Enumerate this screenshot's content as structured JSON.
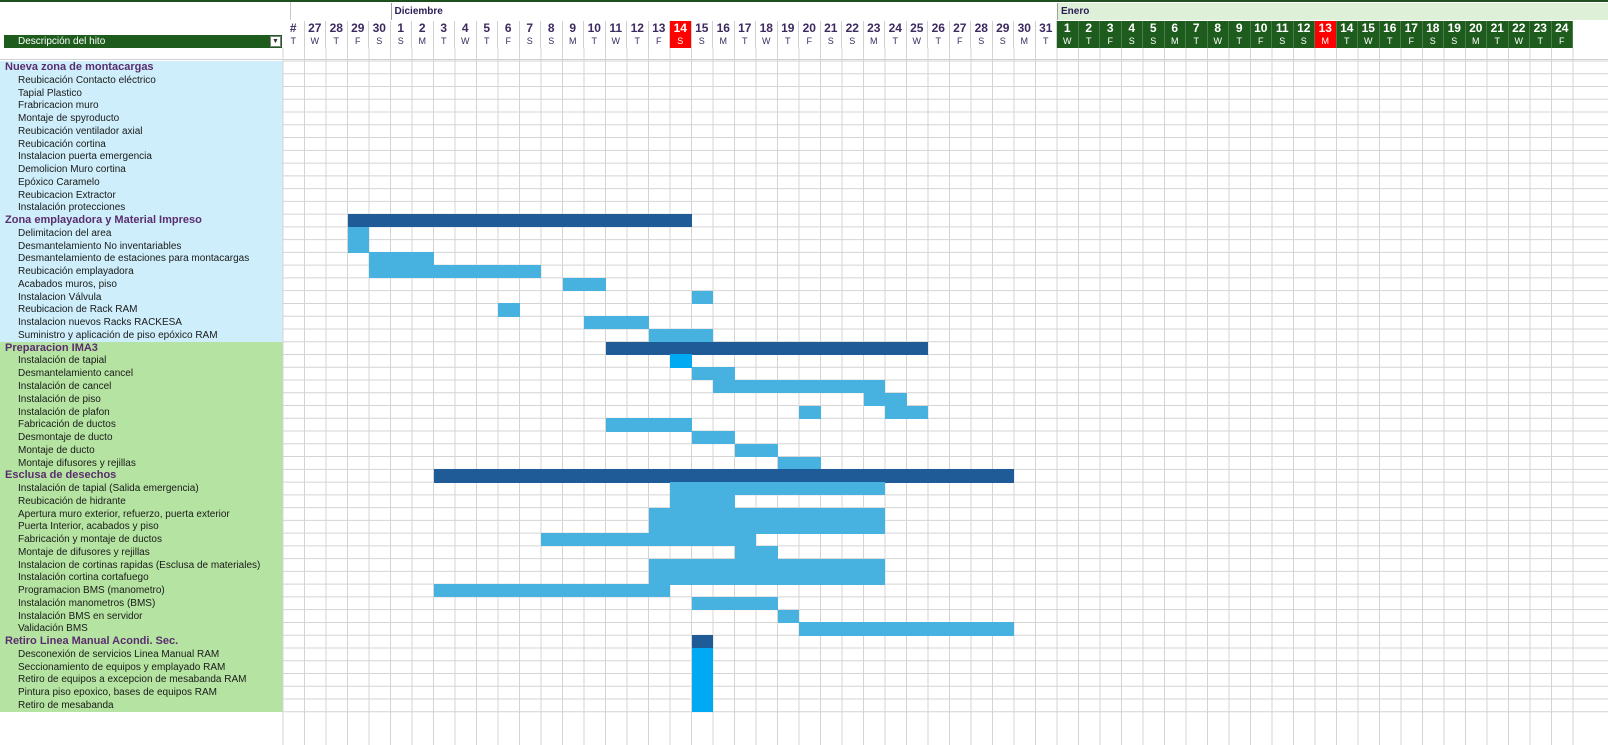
{
  "timeline": {
    "months": [
      {
        "label": "Diciembre",
        "startDay": 5
      },
      {
        "label": "Enero",
        "startDay": 36
      }
    ],
    "days": [
      {
        "num": "#",
        "dow": "T"
      },
      {
        "num": "27",
        "dow": "W"
      },
      {
        "num": "28",
        "dow": "T"
      },
      {
        "num": "29",
        "dow": "F"
      },
      {
        "num": "30",
        "dow": "S"
      },
      {
        "num": "1",
        "dow": "S"
      },
      {
        "num": "2",
        "dow": "M"
      },
      {
        "num": "3",
        "dow": "T"
      },
      {
        "num": "4",
        "dow": "W"
      },
      {
        "num": "5",
        "dow": "T"
      },
      {
        "num": "6",
        "dow": "F"
      },
      {
        "num": "7",
        "dow": "S"
      },
      {
        "num": "8",
        "dow": "S"
      },
      {
        "num": "9",
        "dow": "M"
      },
      {
        "num": "10",
        "dow": "T"
      },
      {
        "num": "11",
        "dow": "W"
      },
      {
        "num": "12",
        "dow": "T"
      },
      {
        "num": "13",
        "dow": "F"
      },
      {
        "num": "14",
        "dow": "S",
        "highlight": true
      },
      {
        "num": "15",
        "dow": "S"
      },
      {
        "num": "16",
        "dow": "M"
      },
      {
        "num": "17",
        "dow": "T"
      },
      {
        "num": "18",
        "dow": "W"
      },
      {
        "num": "19",
        "dow": "T"
      },
      {
        "num": "20",
        "dow": "F"
      },
      {
        "num": "21",
        "dow": "S"
      },
      {
        "num": "22",
        "dow": "S"
      },
      {
        "num": "23",
        "dow": "M"
      },
      {
        "num": "24",
        "dow": "T"
      },
      {
        "num": "25",
        "dow": "W"
      },
      {
        "num": "26",
        "dow": "T"
      },
      {
        "num": "27",
        "dow": "F"
      },
      {
        "num": "28",
        "dow": "S"
      },
      {
        "num": "29",
        "dow": "S"
      },
      {
        "num": "30",
        "dow": "M"
      },
      {
        "num": "31",
        "dow": "T"
      },
      {
        "num": "1",
        "dow": "W",
        "jan": true
      },
      {
        "num": "2",
        "dow": "T",
        "jan": true
      },
      {
        "num": "3",
        "dow": "F",
        "jan": true
      },
      {
        "num": "4",
        "dow": "S",
        "jan": true
      },
      {
        "num": "5",
        "dow": "S",
        "jan": true
      },
      {
        "num": "6",
        "dow": "M",
        "jan": true
      },
      {
        "num": "7",
        "dow": "T",
        "jan": true
      },
      {
        "num": "8",
        "dow": "W",
        "jan": true
      },
      {
        "num": "9",
        "dow": "T",
        "jan": true
      },
      {
        "num": "10",
        "dow": "F",
        "jan": true
      },
      {
        "num": "11",
        "dow": "S",
        "jan": true
      },
      {
        "num": "12",
        "dow": "S",
        "jan": true
      },
      {
        "num": "13",
        "dow": "M",
        "jan": true,
        "highlight": true
      },
      {
        "num": "14",
        "dow": "T",
        "jan": true
      },
      {
        "num": "15",
        "dow": "W",
        "jan": true
      },
      {
        "num": "16",
        "dow": "T",
        "jan": true
      },
      {
        "num": "17",
        "dow": "F",
        "jan": true
      },
      {
        "num": "18",
        "dow": "S",
        "jan": true
      },
      {
        "num": "19",
        "dow": "S",
        "jan": true
      },
      {
        "num": "20",
        "dow": "M",
        "jan": true
      },
      {
        "num": "21",
        "dow": "T",
        "jan": true
      },
      {
        "num": "22",
        "dow": "W",
        "jan": true
      },
      {
        "num": "23",
        "dow": "T",
        "jan": true
      },
      {
        "num": "24",
        "dow": "F",
        "jan": true
      }
    ]
  },
  "header": {
    "description_label": "Descripción del hito",
    "filter_glyph": "▼"
  },
  "colors": {
    "summary_bar": "#1f5b96",
    "task_bar": "#47b1e0",
    "accent_bar": "#00aaf2",
    "blue_band": "#cdeefa",
    "green_band": "#b5e4a2",
    "highlight": "#ff0000",
    "header_green": "#1e5c1e"
  },
  "rows": [
    {
      "type": "category",
      "band": "blue",
      "label": "Nueva zona de montacargas",
      "bars": []
    },
    {
      "type": "task",
      "band": "blue",
      "label": "Reubicación Contacto eléctrico",
      "bars": []
    },
    {
      "type": "task",
      "band": "blue",
      "label": "Tapial Plastico",
      "bars": []
    },
    {
      "type": "task",
      "band": "blue",
      "label": "Frabricacion muro",
      "bars": []
    },
    {
      "type": "task",
      "band": "blue",
      "label": "Montaje de spyroducto",
      "bars": []
    },
    {
      "type": "task",
      "band": "blue",
      "label": "Reubicación ventilador axial",
      "bars": []
    },
    {
      "type": "task",
      "band": "blue",
      "label": "Reubicación cortina",
      "bars": []
    },
    {
      "type": "task",
      "band": "blue",
      "label": "Instalacion puerta emergencia",
      "bars": []
    },
    {
      "type": "task",
      "band": "blue",
      "label": "Demolicion Muro cortina",
      "bars": []
    },
    {
      "type": "task",
      "band": "blue",
      "label": "Epóxico Caramelo",
      "bars": []
    },
    {
      "type": "task",
      "band": "blue",
      "label": "Reubicacion Extractor",
      "bars": []
    },
    {
      "type": "task",
      "band": "blue",
      "label": "Instalación protecciones",
      "bars": []
    },
    {
      "type": "category",
      "band": "blue",
      "label": "Zona emplayadora y Material Impreso",
      "bars": [
        {
          "start": 3,
          "end": 19,
          "kind": "summary"
        }
      ]
    },
    {
      "type": "task",
      "band": "blue",
      "label": "Delimitacion del area",
      "bars": [
        {
          "start": 3,
          "end": 4,
          "kind": "task"
        }
      ]
    },
    {
      "type": "task",
      "band": "blue",
      "label": "Desmantelamiento No inventariables",
      "bars": [
        {
          "start": 3,
          "end": 4,
          "kind": "task"
        }
      ]
    },
    {
      "type": "task",
      "band": "blue",
      "label": "Desmantelamiento de estaciones para montacargas",
      "bars": [
        {
          "start": 4,
          "end": 7,
          "kind": "task"
        }
      ]
    },
    {
      "type": "task",
      "band": "blue",
      "label": "Reubicación emplayadora",
      "bars": [
        {
          "start": 4,
          "end": 12,
          "kind": "task"
        }
      ]
    },
    {
      "type": "task",
      "band": "blue",
      "label": "Acabados muros, piso",
      "bars": [
        {
          "start": 13,
          "end": 15,
          "kind": "task"
        }
      ]
    },
    {
      "type": "task",
      "band": "blue",
      "label": "Instalacion Válvula",
      "bars": [
        {
          "start": 19,
          "end": 20,
          "kind": "task"
        }
      ]
    },
    {
      "type": "task",
      "band": "blue",
      "label": "Reubicacion de Rack RAM",
      "bars": [
        {
          "start": 10,
          "end": 11,
          "kind": "task"
        }
      ]
    },
    {
      "type": "task",
      "band": "blue",
      "label": "Instalacion nuevos Racks RACKESA",
      "bars": [
        {
          "start": 14,
          "end": 17,
          "kind": "task"
        }
      ]
    },
    {
      "type": "task",
      "band": "blue",
      "label": "Suministro y aplicación de piso epóxico RAM",
      "bars": [
        {
          "start": 17,
          "end": 20,
          "kind": "task"
        }
      ]
    },
    {
      "type": "category",
      "band": "green",
      "label": "Preparacion IMA3",
      "bars": [
        {
          "start": 15,
          "end": 30,
          "kind": "summary"
        }
      ]
    },
    {
      "type": "task",
      "band": "green",
      "label": "Instalación de tapial",
      "bars": [
        {
          "start": 18,
          "end": 19,
          "kind": "accent"
        }
      ]
    },
    {
      "type": "task",
      "band": "green",
      "label": "Desmantelamiento cancel",
      "bars": [
        {
          "start": 19,
          "end": 21,
          "kind": "task"
        }
      ]
    },
    {
      "type": "task",
      "band": "green",
      "label": "Instalación de cancel",
      "bars": [
        {
          "start": 20,
          "end": 28,
          "kind": "task"
        }
      ]
    },
    {
      "type": "task",
      "band": "green",
      "label": "Instalación de piso",
      "bars": [
        {
          "start": 27,
          "end": 29,
          "kind": "task"
        }
      ]
    },
    {
      "type": "task",
      "band": "green",
      "label": "Instalación de plafon",
      "bars": [
        {
          "start": 24,
          "end": 25,
          "kind": "task"
        },
        {
          "start": 28,
          "end": 30,
          "kind": "task"
        }
      ]
    },
    {
      "type": "task",
      "band": "green",
      "label": "Fabricación de ductos",
      "bars": [
        {
          "start": 15,
          "end": 19,
          "kind": "task"
        }
      ]
    },
    {
      "type": "task",
      "band": "green",
      "label": "Desmontaje de ducto",
      "bars": [
        {
          "start": 19,
          "end": 21,
          "kind": "task"
        }
      ]
    },
    {
      "type": "task",
      "band": "green",
      "label": "Montaje de ducto",
      "bars": [
        {
          "start": 21,
          "end": 23,
          "kind": "task"
        }
      ]
    },
    {
      "type": "task",
      "band": "green",
      "label": "Montaje difusores y rejillas",
      "bars": [
        {
          "start": 23,
          "end": 25,
          "kind": "task"
        }
      ]
    },
    {
      "type": "category",
      "band": "green",
      "label": "Esclusa de desechos",
      "bars": [
        {
          "start": 7,
          "end": 34,
          "kind": "summary"
        }
      ]
    },
    {
      "type": "task",
      "band": "green",
      "label": "Instalación de tapial (Salida emergencia)",
      "bars": [
        {
          "start": 18,
          "end": 28,
          "kind": "task"
        }
      ]
    },
    {
      "type": "task",
      "band": "green",
      "label": "Reubicación de hidrante",
      "bars": [
        {
          "start": 18,
          "end": 21,
          "kind": "task"
        }
      ]
    },
    {
      "type": "task",
      "band": "green",
      "label": "Apertura muro exterior, refuerzo, puerta exterior",
      "bars": [
        {
          "start": 17,
          "end": 28,
          "kind": "task"
        }
      ]
    },
    {
      "type": "task",
      "band": "green",
      "label": "Puerta Interior, acabados y piso",
      "bars": [
        {
          "start": 17,
          "end": 28,
          "kind": "task"
        }
      ]
    },
    {
      "type": "task",
      "band": "green",
      "label": "Fabricación y montaje de ductos",
      "bars": [
        {
          "start": 12,
          "end": 22,
          "kind": "task"
        }
      ]
    },
    {
      "type": "task",
      "band": "green",
      "label": "Montaje de difusores y rejillas",
      "bars": [
        {
          "start": 21,
          "end": 23,
          "kind": "task"
        }
      ]
    },
    {
      "type": "task",
      "band": "green",
      "label": "Instalacion de cortinas  rapidas (Esclusa de materiales)",
      "bars": [
        {
          "start": 17,
          "end": 28,
          "kind": "task"
        }
      ]
    },
    {
      "type": "task",
      "band": "green",
      "label": "Instalación cortina cortafuego",
      "bars": [
        {
          "start": 17,
          "end": 28,
          "kind": "task"
        }
      ]
    },
    {
      "type": "task",
      "band": "green",
      "label": "Programacion BMS (manometro)",
      "bars": [
        {
          "start": 7,
          "end": 18,
          "kind": "task"
        }
      ]
    },
    {
      "type": "task",
      "band": "green",
      "label": "Instalación manometros (BMS)",
      "bars": [
        {
          "start": 19,
          "end": 23,
          "kind": "task"
        }
      ]
    },
    {
      "type": "task",
      "band": "green",
      "label": "Instalación BMS en servidor",
      "bars": [
        {
          "start": 23,
          "end": 24,
          "kind": "task"
        }
      ]
    },
    {
      "type": "task",
      "band": "green",
      "label": "Validación BMS",
      "bars": [
        {
          "start": 24,
          "end": 34,
          "kind": "task"
        }
      ]
    },
    {
      "type": "category",
      "band": "green",
      "label": "Retiro Linea Manual Acondi. Sec.",
      "bars": [
        {
          "start": 19,
          "end": 20,
          "kind": "summary"
        }
      ]
    },
    {
      "type": "task",
      "band": "green",
      "label": "Desconexión de servicios Linea Manual RAM",
      "bars": [
        {
          "start": 19,
          "end": 20,
          "kind": "accent"
        }
      ]
    },
    {
      "type": "task",
      "band": "green",
      "label": "Seccionamiento de equipos y emplayado RAM",
      "bars": [
        {
          "start": 19,
          "end": 20,
          "kind": "accent"
        }
      ]
    },
    {
      "type": "task",
      "band": "green",
      "label": "Retiro de equipos a excepcion de mesabanda RAM",
      "bars": [
        {
          "start": 19,
          "end": 20,
          "kind": "accent"
        }
      ]
    },
    {
      "type": "task",
      "band": "green",
      "label": "Pintura piso epoxico, bases de equipos RAM",
      "bars": [
        {
          "start": 19,
          "end": 20,
          "kind": "accent"
        }
      ]
    },
    {
      "type": "task",
      "band": "green",
      "label": "Retiro de mesabanda",
      "bars": [
        {
          "start": 19,
          "end": 20,
          "kind": "accent"
        }
      ]
    }
  ]
}
